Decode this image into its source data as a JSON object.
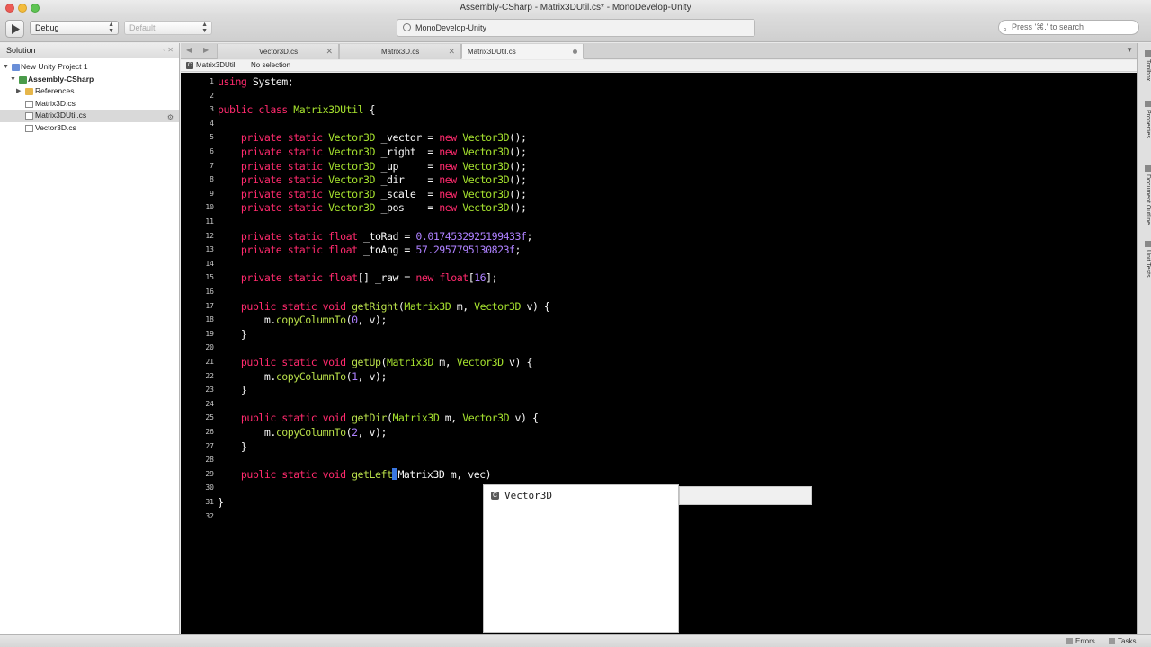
{
  "window": {
    "title": "Assembly-CSharp - Matrix3DUtil.cs* - MonoDevelop-Unity"
  },
  "toolbar": {
    "configuration": "Debug",
    "platform": "Default",
    "status": "MonoDevelop-Unity",
    "search_placeholder": "Press '⌘.' to search"
  },
  "solution": {
    "title": "Solution",
    "items": [
      {
        "label": "New Unity Project 1",
        "icon": "solution-icon",
        "level": 0
      },
      {
        "label": "Assembly-CSharp",
        "icon": "project-icon",
        "level": 1
      },
      {
        "label": "References",
        "icon": "folder-icon",
        "level": 2
      },
      {
        "label": "Matrix3D.cs",
        "icon": "file-icon",
        "level": 2
      },
      {
        "label": "Matrix3DUtil.cs",
        "icon": "file-icon",
        "level": 2
      },
      {
        "label": "Vector3D.cs",
        "icon": "file-icon",
        "level": 2
      }
    ]
  },
  "tabs": [
    {
      "label": "Vector3D.cs"
    },
    {
      "label": "Matrix3D.cs"
    },
    {
      "label": "Matrix3DUtil.cs"
    }
  ],
  "pathbar": {
    "class": "Matrix3DUtil",
    "member": "No selection"
  },
  "editor": {
    "line_numbers": [
      "1",
      "2",
      "3",
      "4",
      "5",
      "6",
      "7",
      "8",
      "9",
      "10",
      "11",
      "12",
      "13",
      "14",
      "15",
      "16",
      "17",
      "18",
      "19",
      "20",
      "21",
      "22",
      "23",
      "24",
      "25",
      "26",
      "27",
      "28",
      "29",
      "30",
      "31",
      "32"
    ],
    "lines": [
      [
        [
          "kw",
          "using"
        ],
        [
          "id",
          " System;"
        ]
      ],
      [],
      [
        [
          "kw",
          "public"
        ],
        [
          "id",
          " "
        ],
        [
          "kw",
          "class"
        ],
        [
          "id",
          " "
        ],
        [
          "ty",
          "Matrix3DUtil"
        ],
        [
          "id",
          " {"
        ]
      ],
      [],
      [
        [
          "id",
          "    "
        ],
        [
          "kw",
          "private"
        ],
        [
          "id",
          " "
        ],
        [
          "kw",
          "static"
        ],
        [
          "id",
          " "
        ],
        [
          "ty",
          "Vector3D"
        ],
        [
          "id",
          " _vector = "
        ],
        [
          "kw",
          "new"
        ],
        [
          "id",
          " "
        ],
        [
          "ty",
          "Vector3D"
        ],
        [
          "id",
          "();"
        ]
      ],
      [
        [
          "id",
          "    "
        ],
        [
          "kw",
          "private"
        ],
        [
          "id",
          " "
        ],
        [
          "kw",
          "static"
        ],
        [
          "id",
          " "
        ],
        [
          "ty",
          "Vector3D"
        ],
        [
          "id",
          " _right  = "
        ],
        [
          "kw",
          "new"
        ],
        [
          "id",
          " "
        ],
        [
          "ty",
          "Vector3D"
        ],
        [
          "id",
          "();"
        ]
      ],
      [
        [
          "id",
          "    "
        ],
        [
          "kw",
          "private"
        ],
        [
          "id",
          " "
        ],
        [
          "kw",
          "static"
        ],
        [
          "id",
          " "
        ],
        [
          "ty",
          "Vector3D"
        ],
        [
          "id",
          " _up     = "
        ],
        [
          "kw",
          "new"
        ],
        [
          "id",
          " "
        ],
        [
          "ty",
          "Vector3D"
        ],
        [
          "id",
          "();"
        ]
      ],
      [
        [
          "id",
          "    "
        ],
        [
          "kw",
          "private"
        ],
        [
          "id",
          " "
        ],
        [
          "kw",
          "static"
        ],
        [
          "id",
          " "
        ],
        [
          "ty",
          "Vector3D"
        ],
        [
          "id",
          " _dir    = "
        ],
        [
          "kw",
          "new"
        ],
        [
          "id",
          " "
        ],
        [
          "ty",
          "Vector3D"
        ],
        [
          "id",
          "();"
        ]
      ],
      [
        [
          "id",
          "    "
        ],
        [
          "kw",
          "private"
        ],
        [
          "id",
          " "
        ],
        [
          "kw",
          "static"
        ],
        [
          "id",
          " "
        ],
        [
          "ty",
          "Vector3D"
        ],
        [
          "id",
          " _scale  = "
        ],
        [
          "kw",
          "new"
        ],
        [
          "id",
          " "
        ],
        [
          "ty",
          "Vector3D"
        ],
        [
          "id",
          "();"
        ]
      ],
      [
        [
          "id",
          "    "
        ],
        [
          "kw",
          "private"
        ],
        [
          "id",
          " "
        ],
        [
          "kw",
          "static"
        ],
        [
          "id",
          " "
        ],
        [
          "ty",
          "Vector3D"
        ],
        [
          "id",
          " _pos    = "
        ],
        [
          "kw",
          "new"
        ],
        [
          "id",
          " "
        ],
        [
          "ty",
          "Vector3D"
        ],
        [
          "id",
          "();"
        ]
      ],
      [],
      [
        [
          "id",
          "    "
        ],
        [
          "kw",
          "private"
        ],
        [
          "id",
          " "
        ],
        [
          "kw",
          "static"
        ],
        [
          "id",
          " "
        ],
        [
          "kw",
          "float"
        ],
        [
          "id",
          " _toRad = "
        ],
        [
          "num",
          "0.0174532925199433f"
        ],
        [
          "id",
          ";"
        ]
      ],
      [
        [
          "id",
          "    "
        ],
        [
          "kw",
          "private"
        ],
        [
          "id",
          " "
        ],
        [
          "kw",
          "static"
        ],
        [
          "id",
          " "
        ],
        [
          "kw",
          "float"
        ],
        [
          "id",
          " _toAng = "
        ],
        [
          "num",
          "57.2957795130823f"
        ],
        [
          "id",
          ";"
        ]
      ],
      [],
      [
        [
          "id",
          "    "
        ],
        [
          "kw",
          "private"
        ],
        [
          "id",
          " "
        ],
        [
          "kw",
          "static"
        ],
        [
          "id",
          " "
        ],
        [
          "kw",
          "float"
        ],
        [
          "id",
          "[] _raw = "
        ],
        [
          "kw",
          "new"
        ],
        [
          "id",
          " "
        ],
        [
          "kw",
          "float"
        ],
        [
          "id",
          "["
        ],
        [
          "num",
          "16"
        ],
        [
          "id",
          "];"
        ]
      ],
      [],
      [
        [
          "id",
          "    "
        ],
        [
          "kw",
          "public"
        ],
        [
          "id",
          " "
        ],
        [
          "kw",
          "static"
        ],
        [
          "id",
          " "
        ],
        [
          "kw",
          "void"
        ],
        [
          "id",
          " "
        ],
        [
          "fn",
          "getRight"
        ],
        [
          "id",
          "("
        ],
        [
          "ty",
          "Matrix3D"
        ],
        [
          "id",
          " m, "
        ],
        [
          "ty",
          "Vector3D"
        ],
        [
          "id",
          " v) {"
        ]
      ],
      [
        [
          "id",
          "        m."
        ],
        [
          "fn",
          "copyColumnTo"
        ],
        [
          "id",
          "("
        ],
        [
          "num",
          "0"
        ],
        [
          "id",
          ", v);"
        ]
      ],
      [
        [
          "id",
          "    }"
        ]
      ],
      [],
      [
        [
          "id",
          "    "
        ],
        [
          "kw",
          "public"
        ],
        [
          "id",
          " "
        ],
        [
          "kw",
          "static"
        ],
        [
          "id",
          " "
        ],
        [
          "kw",
          "void"
        ],
        [
          "id",
          " "
        ],
        [
          "fn",
          "getUp"
        ],
        [
          "id",
          "("
        ],
        [
          "ty",
          "Matrix3D"
        ],
        [
          "id",
          " m, "
        ],
        [
          "ty",
          "Vector3D"
        ],
        [
          "id",
          " v) {"
        ]
      ],
      [
        [
          "id",
          "        m."
        ],
        [
          "fn",
          "copyColumnTo"
        ],
        [
          "id",
          "("
        ],
        [
          "num",
          "1"
        ],
        [
          "id",
          ", v);"
        ]
      ],
      [
        [
          "id",
          "    }"
        ]
      ],
      [],
      [
        [
          "id",
          "    "
        ],
        [
          "kw",
          "public"
        ],
        [
          "id",
          " "
        ],
        [
          "kw",
          "static"
        ],
        [
          "id",
          " "
        ],
        [
          "kw",
          "void"
        ],
        [
          "id",
          " "
        ],
        [
          "fn",
          "getDir"
        ],
        [
          "id",
          "("
        ],
        [
          "ty",
          "Matrix3D"
        ],
        [
          "id",
          " m, "
        ],
        [
          "ty",
          "Vector3D"
        ],
        [
          "id",
          " v) {"
        ]
      ],
      [
        [
          "id",
          "        m."
        ],
        [
          "fn",
          "copyColumnTo"
        ],
        [
          "id",
          "("
        ],
        [
          "num",
          "2"
        ],
        [
          "id",
          ", v);"
        ]
      ],
      [
        [
          "id",
          "    }"
        ]
      ],
      [],
      [
        [
          "id",
          "    "
        ],
        [
          "kw",
          "public"
        ],
        [
          "id",
          " "
        ],
        [
          "kw",
          "static"
        ],
        [
          "id",
          " "
        ],
        [
          "kw",
          "void"
        ],
        [
          "id",
          " "
        ],
        [
          "fn",
          "getLeft"
        ],
        [
          "caret",
          ""
        ],
        [
          "id",
          "Matrix3D m, vec)"
        ]
      ],
      [],
      [
        [
          "id",
          "}"
        ]
      ],
      []
    ]
  },
  "completion": {
    "item": "Vector3D",
    "item_icon": "class-icon"
  },
  "right_pads": [
    "Toolbox",
    "Properties",
    "Document Outline",
    "Unit Tests"
  ],
  "statusbar": {
    "errors": "Errors",
    "tasks": "Tasks"
  }
}
